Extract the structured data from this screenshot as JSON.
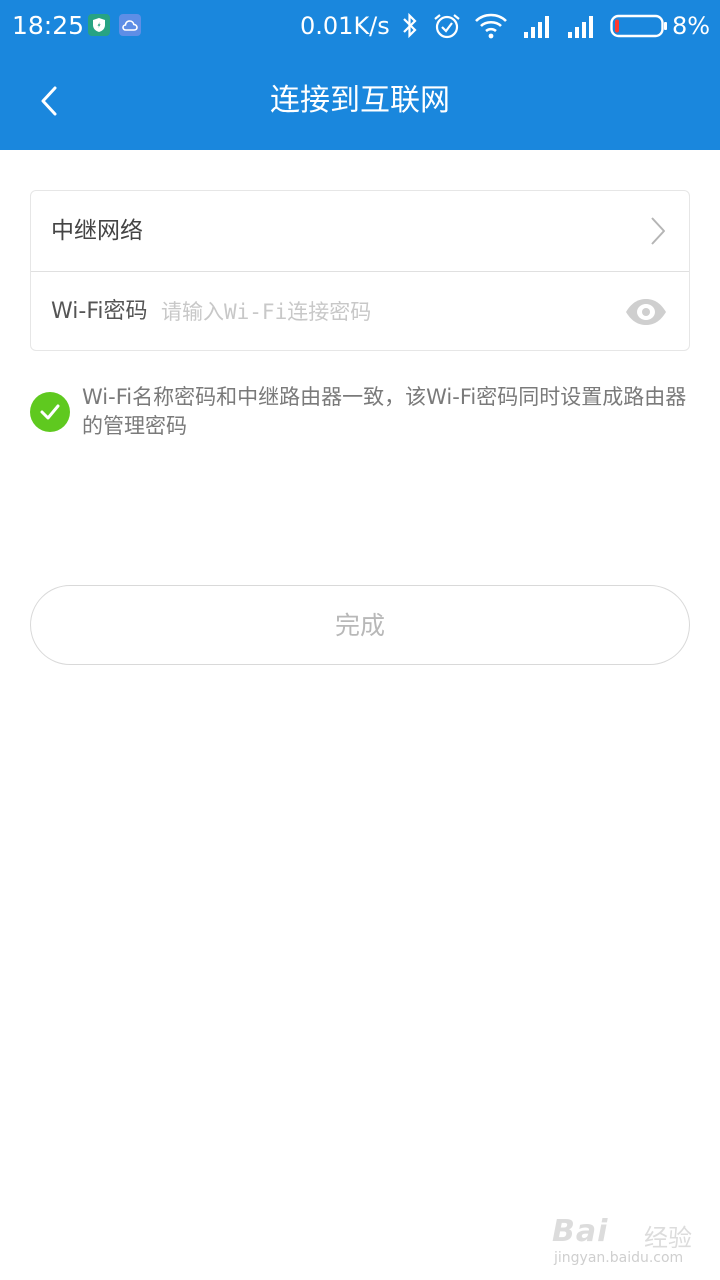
{
  "status_bar": {
    "time": "18:25",
    "net_speed": "0.01K/s",
    "battery_percent": "8%",
    "battery_level": 0.08,
    "icons": [
      "shield-badge-icon",
      "cloud-badge-icon",
      "bluetooth-icon",
      "alarm-icon",
      "wifi-icon",
      "signal-icon",
      "signal-icon-2",
      "battery-icon"
    ]
  },
  "header": {
    "title": "连接到互联网",
    "back_icon": "chevron-left-icon"
  },
  "form": {
    "network_label": "中继网络",
    "password_label": "Wi-Fi密码",
    "password_placeholder": "请输入Wi-Fi连接密码",
    "password_value": ""
  },
  "notice": {
    "checked": true,
    "text": "Wi-Fi名称密码和中继路由器一致，该Wi-Fi密码同时设置成路由器的管理密码"
  },
  "done_button": {
    "label": "完成"
  },
  "watermark": {
    "brand": "Bai",
    "suffix": "经验",
    "url": "jingyan.baidu.com"
  },
  "colors": {
    "primary": "#1a87dd",
    "check": "#5fc91f",
    "text_secondary": "#7a7a7a"
  }
}
